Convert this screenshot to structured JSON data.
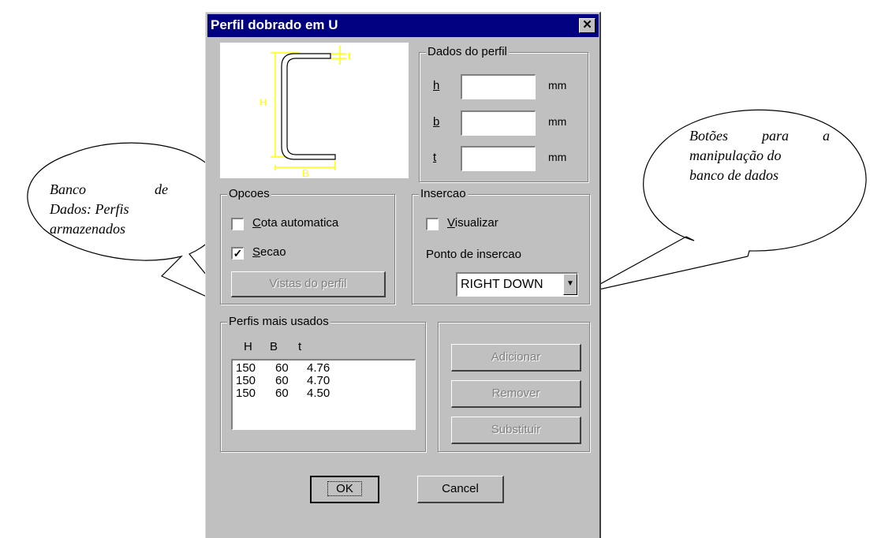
{
  "window": {
    "title": "Perfil dobrado em U",
    "close_symbol": "✕"
  },
  "diagram": {
    "label_H": "H",
    "label_B": "B",
    "label_t": "t"
  },
  "dados_perfil": {
    "title": "Dados do perfil",
    "fields": [
      {
        "label": "h",
        "value": "",
        "unit": "mm"
      },
      {
        "label": "b",
        "value": "",
        "unit": "mm"
      },
      {
        "label": "t",
        "value": "",
        "unit": "mm"
      }
    ]
  },
  "opcoes": {
    "title": "Opcoes",
    "cota_label": "Cota automatica",
    "cota_checked": false,
    "secao_label": "Secao",
    "secao_checked": true,
    "vistas_button": "Vistas do perfil"
  },
  "insercao": {
    "title": "Insercao",
    "visualizar_label": "Visualizar",
    "visualizar_checked": false,
    "ponto_label": "Ponto de insercao",
    "ponto_value": "RIGHT DOWN"
  },
  "perfis": {
    "title": "Perfis mais usados",
    "headers": [
      "H",
      "B",
      "t"
    ],
    "rows": [
      [
        "150",
        "60",
        "4.76"
      ],
      [
        "150",
        "60",
        "4.70"
      ],
      [
        "150",
        "60",
        "4.50"
      ]
    ]
  },
  "db_buttons": {
    "adicionar": "Adicionar",
    "remover": "Remover",
    "substituir": "Substituir"
  },
  "footer": {
    "ok": "OK",
    "cancel": "Cancel"
  },
  "callouts": {
    "left_lines": [
      "Banco de",
      "Dados: Perfis",
      "armazenados"
    ],
    "right_lines": [
      "Botões para a",
      "manipulação do",
      "banco de dados"
    ]
  },
  "colors": {
    "titlebar": "#000080",
    "face": "#c0c0c0",
    "diagram": "#ffff00"
  }
}
